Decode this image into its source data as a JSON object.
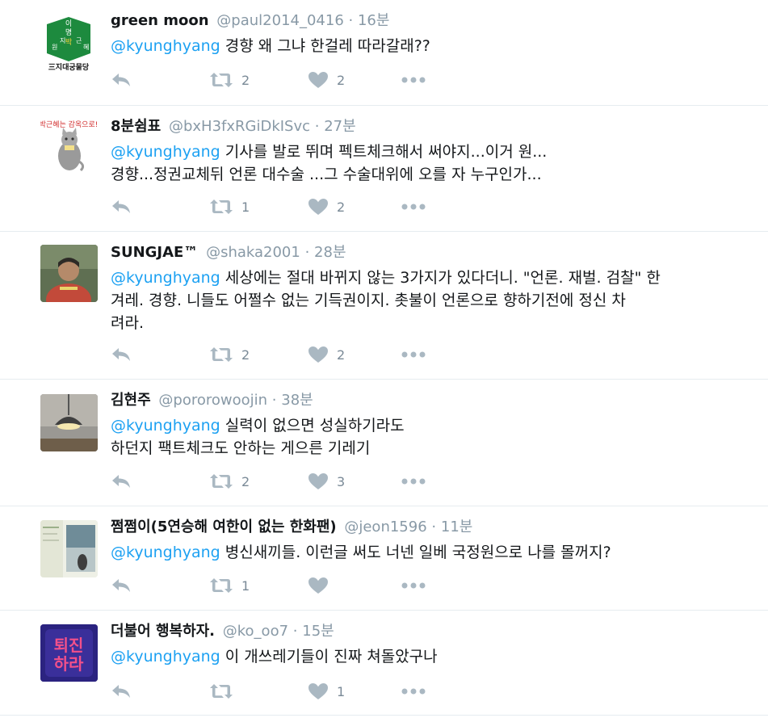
{
  "colors": {
    "accent": "#1da1f2",
    "muted": "#8899a6",
    "divider": "#e6ecf0",
    "icon": "#aab8c2"
  },
  "icons": {
    "reply": "reply-icon",
    "retweet": "retweet-icon",
    "like": "heart-icon",
    "more": "more-icon"
  },
  "tweets": [
    {
      "name": "green moon",
      "handle": "@paul2014_0416",
      "sep": "·",
      "time": "16분",
      "mention": "@kyunghyang",
      "text": " 경향 왜 그냐 한걸레 따라갈래??",
      "text2": "",
      "text3": "",
      "retweets": "2",
      "likes": "2",
      "avatar": {
        "line1": "이 명",
        "line2": "원지 박 근혜",
        "bottom": "三지대궁물당"
      }
    },
    {
      "name": "8분쉼표",
      "handle": "@bxH3fxRGiDkISvc",
      "sep": "·",
      "time": "27분",
      "mention": "@kyunghyang",
      "text": " 기사를 발로 뛰며 펙트체크해서 써야지...이거 원...",
      "text2": "경향...정권교체뒤 언론 대수술 ...그 수술대위에 오를 자 누구인가...",
      "text3": "",
      "retweets": "1",
      "likes": "2",
      "avatar": {
        "caption": "박근혜는 감옥으로!"
      }
    },
    {
      "name": "SUNGJAE™",
      "handle": "@shaka2001",
      "sep": "·",
      "time": "28분",
      "mention": "@kyunghyang",
      "text": " 세상에는 절대 바뀌지 않는 3가지가 있다더니. \"언론. 재벌. 검찰\" 한",
      "text2": "겨레. 경향. 니들도 어쩔수 없는 기득권이지. 촛불이 언론으로 향하기전에 정신 차",
      "text3": "려라.",
      "retweets": "2",
      "likes": "2",
      "avatar": {}
    },
    {
      "name": "김현주",
      "handle": "@pororowoojin",
      "sep": "·",
      "time": "38분",
      "mention": "@kyunghyang",
      "text": " 실력이 없으면 성실하기라도",
      "text2": "하던지 팩트체크도 안하는 게으른 기레기",
      "text3": "",
      "retweets": "2",
      "likes": "3",
      "avatar": {}
    },
    {
      "name": "쩜쩜이(5연승해 여한이 없는 한화팬)",
      "handle": "@jeon1596",
      "sep": "·",
      "time": "11분",
      "mention": "@kyunghyang",
      "text": " 병신새끼들. 이런글 써도 너넨 일베 국정원으로 나를 몰꺼지?",
      "text2": "",
      "text3": "",
      "retweets": "1",
      "likes": "",
      "avatar": {}
    },
    {
      "name": "더불어 행복하자.",
      "handle": "@ko_oo7",
      "sep": "·",
      "time": "15분",
      "mention": "@kyunghyang",
      "text": " 이 개쓰레기들이 진짜 쳐돌았구나",
      "text2": "",
      "text3": "",
      "retweets": "",
      "likes": "1",
      "avatar": {
        "line1": "퇴진",
        "line2": "하라"
      }
    }
  ]
}
